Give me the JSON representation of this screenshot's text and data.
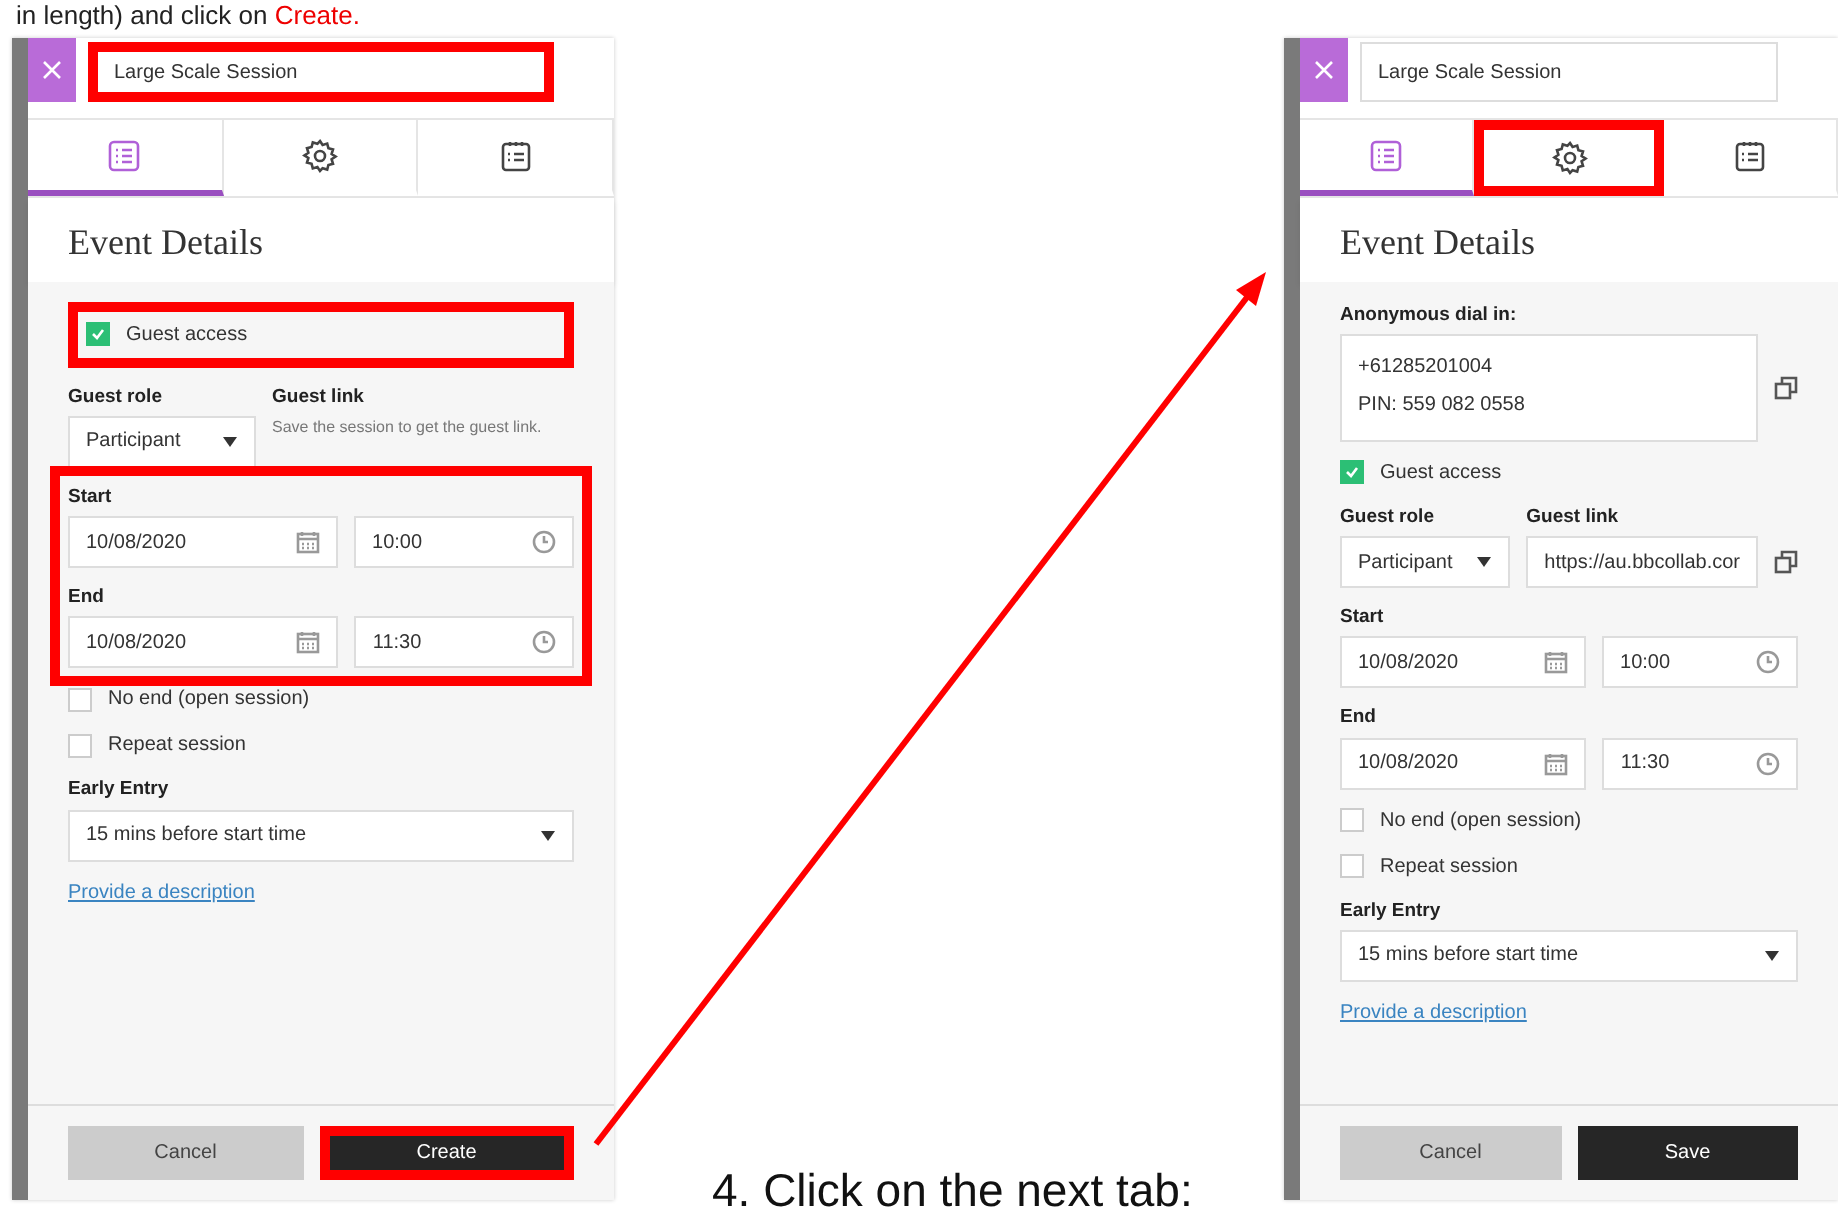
{
  "instruction_top": {
    "text": "in length) and click on ",
    "emphasis": "Create."
  },
  "panels": [
    {
      "title_value": "Large Scale Session",
      "title_highlighted": true,
      "tabs": [
        {
          "kind": "list",
          "selected": true,
          "highlighted": false
        },
        {
          "kind": "gear",
          "selected": false,
          "highlighted": false
        },
        {
          "kind": "clipboard",
          "selected": false,
          "highlighted": false
        }
      ],
      "heading": "Event Details",
      "fields": [
        {
          "kind": "checkbox",
          "label": "Guest access",
          "checked": true,
          "highlighted": true
        },
        {
          "kind": "guest",
          "role_label": "Guest role",
          "role_value": "Participant",
          "link_label": "Guest link",
          "link_hint": "Save the session to get the guest link."
        },
        {
          "kind": "datetimes",
          "highlighted": true,
          "items": [
            {
              "label": "Start",
              "date": "10/08/2020",
              "time": "10:00"
            },
            {
              "label": "End",
              "date": "10/08/2020",
              "time": "11:30"
            }
          ]
        },
        {
          "kind": "checkbox",
          "label": "No end (open session)",
          "checked": false,
          "highlighted": false
        },
        {
          "kind": "checkbox",
          "label": "Repeat session",
          "checked": false,
          "highlighted": false
        },
        {
          "kind": "select",
          "label": "Early Entry",
          "value": "15 mins before start time"
        },
        {
          "kind": "link",
          "text": "Provide a description"
        }
      ],
      "buttons": [
        {
          "label": "Cancel",
          "kind": "secondary",
          "highlighted": false
        },
        {
          "label": "Create",
          "kind": "primary",
          "highlighted": true
        }
      ]
    },
    {
      "title_value": "Large Scale Session",
      "title_highlighted": false,
      "tabs": [
        {
          "kind": "list",
          "selected": true,
          "highlighted": false
        },
        {
          "kind": "gear",
          "selected": false,
          "highlighted": true
        },
        {
          "kind": "clipboard",
          "selected": false,
          "highlighted": false
        }
      ],
      "heading": "Event Details",
      "fields": [
        {
          "kind": "dialin",
          "label": "Anonymous dial in:",
          "lines": [
            "+61285201004",
            "PIN: 559 082 0558"
          ]
        },
        {
          "kind": "checkbox",
          "label": "Guest access",
          "checked": true,
          "highlighted": false
        },
        {
          "kind": "guest",
          "role_label": "Guest role",
          "role_value": "Participant",
          "link_label": "Guest link",
          "link_value": "https://au.bbcollab.cor"
        },
        {
          "kind": "datetimes",
          "highlighted": false,
          "items": [
            {
              "label": "Start",
              "date": "10/08/2020",
              "time": "10:00"
            },
            {
              "label": "End",
              "date": "10/08/2020",
              "time": "11:30"
            }
          ]
        },
        {
          "kind": "checkbox",
          "label": "No end (open session)",
          "checked": false,
          "highlighted": false
        },
        {
          "kind": "checkbox",
          "label": "Repeat session",
          "checked": false,
          "highlighted": false
        },
        {
          "kind": "select",
          "label": "Early Entry",
          "value": "15 mins before start time"
        },
        {
          "kind": "link",
          "text": "Provide a description"
        }
      ],
      "buttons": [
        {
          "label": "Cancel",
          "kind": "secondary",
          "highlighted": false
        },
        {
          "label": "Save",
          "kind": "primary",
          "highlighted": false
        }
      ]
    }
  ],
  "step_text": "4. Click on the next tab:"
}
